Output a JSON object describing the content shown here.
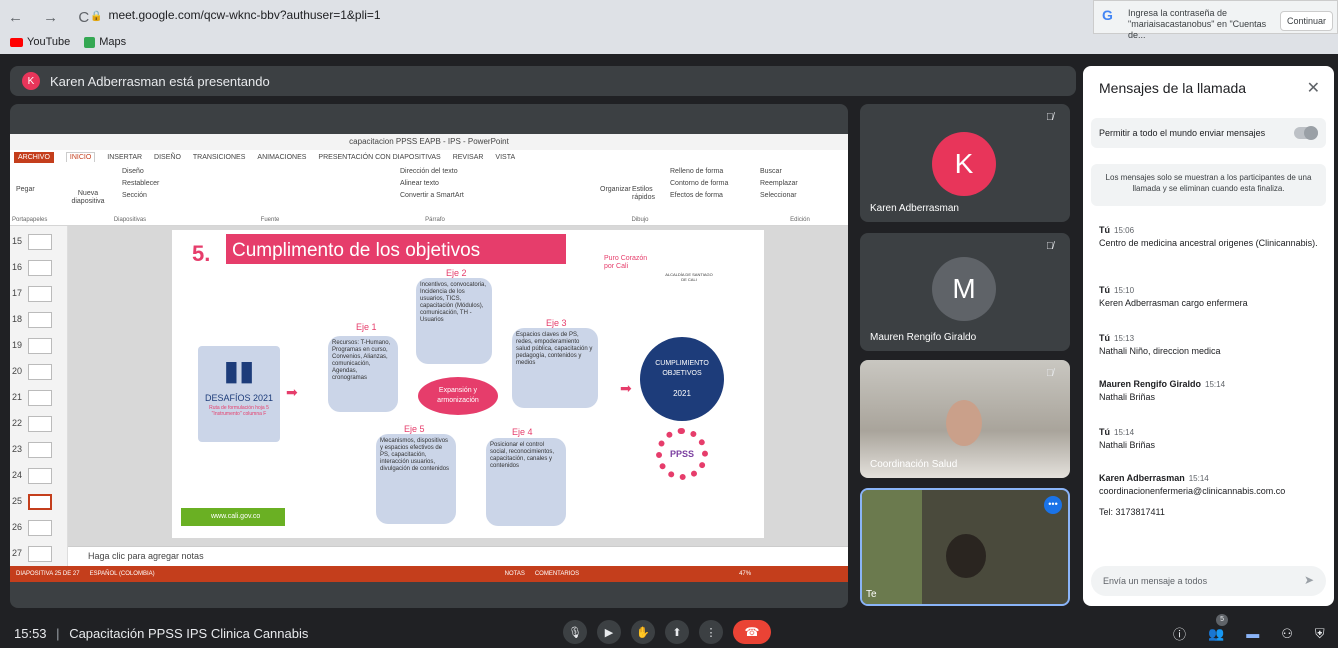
{
  "browser": {
    "nav": "← → C",
    "url": "meet.google.com/qcw-wknc-bbv?authuser=1&pli=1",
    "bookmarks": [
      "YouTube",
      "Maps"
    ],
    "password_prompt": {
      "text": "Ingresa la contraseña de \"mariaisacastanobus\" en \"Cuentas de...",
      "button": "Continuar"
    }
  },
  "banner": {
    "initial": "K",
    "text": "Karen Adberrasman está presentando"
  },
  "powerpoint": {
    "window_title": "capacitacion PPSS EAPB - IPS - PowerPoint",
    "tabs": [
      "ARCHIVO",
      "INICIO",
      "INSERTAR",
      "DISEÑO",
      "TRANSICIONES",
      "ANIMACIONES",
      "PRESENTACIÓN CON DIAPOSITIVAS",
      "REVISAR",
      "VISTA"
    ],
    "ribbon_groups": [
      "Portapapeles",
      "Diapositivas",
      "Fuente",
      "Párrafo",
      "Dibujo",
      "Edición"
    ],
    "ribbon_buttons": {
      "paste": "Pegar",
      "new_slide": "Nueva diapositiva",
      "layout": "Diseño",
      "reset": "Restablecer",
      "section": "Sección",
      "text_dir": "Dirección del texto",
      "align_text": "Alinear texto",
      "smartart": "Convertir a SmartArt",
      "organize": "Organizar",
      "quick_styles": "Estilos rápidos",
      "shape_fill": "Relleno de forma",
      "shape_outline": "Contorno de forma",
      "shape_effects": "Efectos de forma",
      "find": "Buscar",
      "replace": "Reemplazar",
      "select": "Seleccionar"
    },
    "thumbnails": [
      "15",
      "16",
      "17",
      "18",
      "19",
      "20",
      "21",
      "22",
      "23",
      "24",
      "25",
      "26",
      "27"
    ],
    "active_thumb": "25",
    "notes_placeholder": "Haga clic para agregar notas",
    "status": {
      "slide": "DIAPOSITIVA 25 DE 27",
      "lang": "ESPAÑOL (COLOMBIA)",
      "notes": "NOTAS",
      "comments": "COMENTARIOS",
      "zoom": "47%"
    },
    "slide": {
      "number": "5.",
      "title": "Cumplimento de los objetivos",
      "logo_text": "Puro Corazón por Cali",
      "logo2": "ALCALDÍA DE SANTIAGO DE CALI",
      "desafios": "DESAFÍOS 2021",
      "desafios_sub": "Ruta de formulación hoja 5 \"Instrumento\" columna F",
      "center": "Expansión y armonización",
      "cumplimiento": "CUMPLIMIENTO OBJETIVOS",
      "year": "2021",
      "ppss": "PPSS",
      "footer_url": "www.cali.gov.co",
      "ejes": [
        {
          "label": "Eje 1",
          "text": "Recursos: T-Humano, Programas en curso, Convenios, Alianzas, comunicación, Agendas, cronogramas"
        },
        {
          "label": "Eje 2",
          "text": "Incentivos, convocatoria, Incidencia de los usuarios, TICS, capacitación (Módulos), comunicación, TH - Usuarios"
        },
        {
          "label": "Eje 3",
          "text": "Espacios claves de PS, redes, empoderamiento salud pública, capacitación y pedagogía, contenidos y medios"
        },
        {
          "label": "Eje 4",
          "text": "Posicionar el control social, reconocimientos, capacitación, canales y contenidos"
        },
        {
          "label": "Eje 5",
          "text": "Mecanismos, dispositivos y espacios efectivos de PS, capacitación, interacción usuarios, divulgación de contenidos"
        }
      ]
    }
  },
  "participants": [
    {
      "initial": "K",
      "name": "Karen Adberrasman",
      "color": "#e8355a"
    },
    {
      "initial": "M",
      "name": "Mauren Rengifo Giraldo",
      "color": "#5f6368"
    },
    {
      "name": "Coordinación Salud"
    },
    {
      "name": "Te"
    }
  ],
  "chat": {
    "title": "Mensajes de la llamada",
    "permission": "Permitir a todo el mundo enviar mensajes",
    "info": "Los mensajes solo se muestran a los participantes de una llamada y se eliminan cuando esta finaliza.",
    "messages": [
      {
        "who": "Tú",
        "time": "15:06",
        "text": "Centro de medicina ancestral origenes (Clinicannabis)."
      },
      {
        "who": "Tú",
        "time": "15:10",
        "text": "Keren Adberrasman cargo enfermera"
      },
      {
        "who": "Tú",
        "time": "15:13",
        "text": "Nathali Niño, direccion medica"
      },
      {
        "who": "Mauren Rengifo Giraldo",
        "time": "15:14",
        "text": "Nathali Briñas"
      },
      {
        "who": "Tú",
        "time": "15:14",
        "text": "Nathali Briñas"
      },
      {
        "who": "Karen Adberrasman",
        "time": "15:14",
        "text": "coordinacionenfermeria@clinicannabis.com.co"
      }
    ],
    "tel": "Tel: 3173817411",
    "input_placeholder": "Envía un mensaje a todos"
  },
  "bottom": {
    "time": "15:53",
    "meeting": "Capacitación PPSS IPS Clinica Cannabis",
    "people_count": "5"
  },
  "colors": {
    "accent": "#e63d6b",
    "ppt": "#c43e1c",
    "hangup": "#ea4335",
    "chat_icon": "#8ab4f8"
  }
}
